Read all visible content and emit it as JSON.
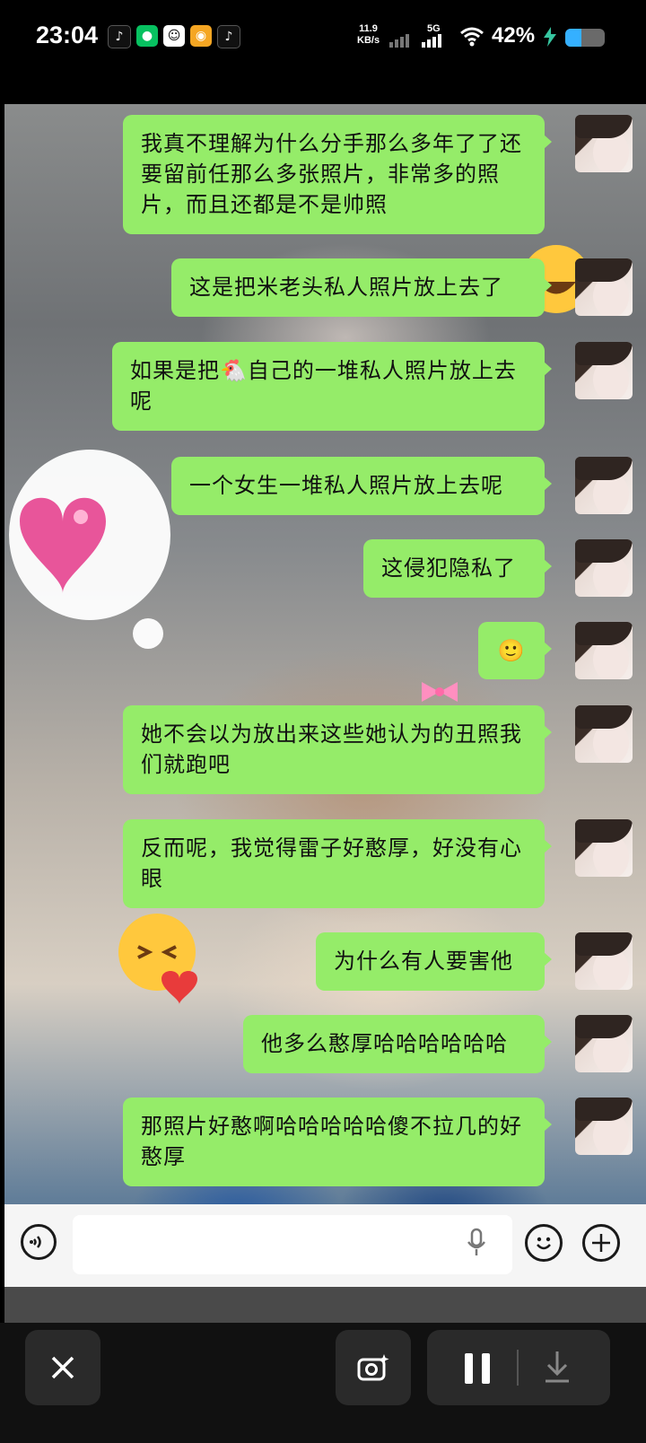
{
  "status_bar": {
    "time": "23:04",
    "net_speed_value": "11.9",
    "net_speed_unit": "KB/s",
    "network": "5G",
    "battery_percent": "42%",
    "battery_level": 0.42,
    "app_icons": [
      "tiktok-lite-icon",
      "wechat-icon",
      "qq-icon",
      "weibo-icon",
      "tiktok-icon"
    ]
  },
  "chat": {
    "messages": [
      {
        "text": "我真不理解为什么分手那么多年了了还要留前任那么多张照片，非常多的照片，而且还都是不是帅照",
        "sender": "me"
      },
      {
        "text": "这是把米老头私人照片放上去了",
        "sender": "me"
      },
      {
        "text": "如果是把🐔自己的一堆私人照片放上去呢",
        "sender": "me"
      },
      {
        "text": "一个女生一堆私人照片放上去呢",
        "sender": "me"
      },
      {
        "text": "这侵犯隐私了",
        "sender": "me"
      },
      {
        "text": "🙂",
        "sender": "me"
      },
      {
        "text": "她不会以为放出来这些她认为的丑照我们就跑吧",
        "sender": "me"
      },
      {
        "text": "反而呢，我觉得雷子好憨厚，好没有心眼",
        "sender": "me"
      },
      {
        "text": "为什么有人要害他",
        "sender": "me"
      },
      {
        "text": "他多么憨厚哈哈哈哈哈哈",
        "sender": "me"
      },
      {
        "text": "那照片好憨啊哈哈哈哈哈傻不拉几的好憨厚",
        "sender": "me"
      }
    ],
    "bubble_color": "#95ec69"
  },
  "input_bar": {
    "placeholder": "",
    "icons": [
      "voice-icon",
      "mic-icon",
      "emoji-icon",
      "plus-icon"
    ]
  },
  "player_controls": {
    "icons": [
      "close-icon",
      "screenshot-icon",
      "pause-icon",
      "download-icon"
    ]
  }
}
